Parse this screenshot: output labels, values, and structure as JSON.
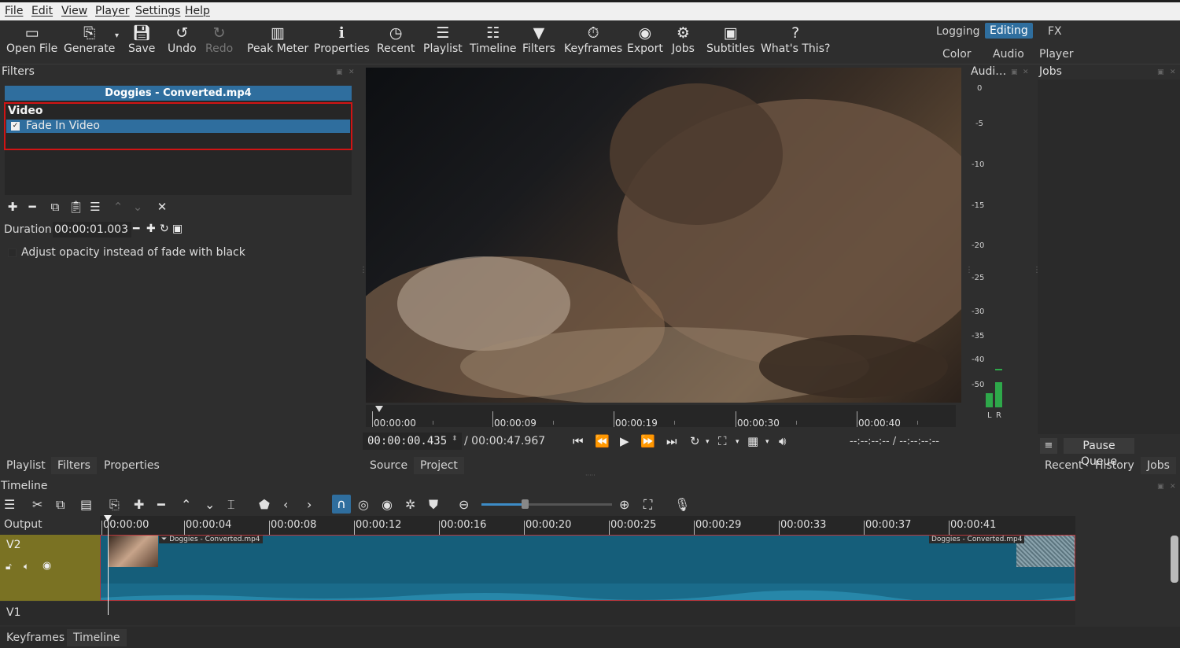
{
  "menu": [
    "File",
    "Edit",
    "View",
    "Player",
    "Settings",
    "Help"
  ],
  "toolbar": {
    "open_file": "Open File",
    "generate": "Generate",
    "save": "Save",
    "undo": "Undo",
    "redo": "Redo",
    "peak_meter": "Peak Meter",
    "properties": "Properties",
    "recent": "Recent",
    "playlist": "Playlist",
    "timeline": "Timeline",
    "filters": "Filters",
    "keyframes": "Keyframes",
    "export": "Export",
    "jobs": "Jobs",
    "subtitles": "Subtitles",
    "whats_this": "What's This?"
  },
  "layouts": {
    "logging": "Logging",
    "editing": "Editing",
    "fx": "FX",
    "color": "Color",
    "audio": "Audio",
    "player": "Player"
  },
  "filters_panel": {
    "title": "Filters",
    "file_name": "Doggies - Converted.mp4",
    "group": "Video",
    "item": "Fade In Video",
    "check": "✓",
    "duration_label": "Duration",
    "duration_value": "00:00:01.003",
    "opacity_label": "Adjust opacity instead of fade with black"
  },
  "left_tabs": {
    "playlist": "Playlist",
    "filters": "Filters",
    "properties": "Properties"
  },
  "player": {
    "ruler": [
      "00:00:00",
      "00:00:09",
      "00:00:19",
      "00:00:30",
      "00:00:40"
    ],
    "timecode": "00:00:00.435",
    "total": "/  00:00:47.967",
    "in_out": "--:--:--:-- / --:--:--:--",
    "source_tab": "Source",
    "project_tab": "Project"
  },
  "audio_meter": {
    "title": "Audi…",
    "scale": [
      "0",
      "-5",
      "-10",
      "-15",
      "-20",
      "-25",
      "-30",
      "-35",
      "-40",
      "-50"
    ],
    "l": "L",
    "r": "R",
    "level_left": 0.18,
    "level_right": 0.3
  },
  "jobs_panel": {
    "title": "Jobs",
    "pause_queue": "Pause Queue",
    "tabs": {
      "recent": "Recent",
      "history": "History",
      "jobs": "Jobs"
    }
  },
  "timeline": {
    "title": "Timeline",
    "output": "Output",
    "ruler": [
      "00:00:00",
      "00:00:04",
      "00:00:08",
      "00:00:12",
      "00:00:16",
      "00:00:20",
      "00:00:25",
      "00:00:29",
      "00:00:33",
      "00:00:37",
      "00:00:41"
    ],
    "tracks": {
      "v2": "V2",
      "v1": "V1"
    },
    "clip_label": "Doggies - Converted.mp4",
    "clip_label_short": "Doggies - Converted.mp4",
    "zoom_level": 0.33
  },
  "bottom_tabs": {
    "keyframes": "Keyframes",
    "timeline": "Timeline"
  }
}
